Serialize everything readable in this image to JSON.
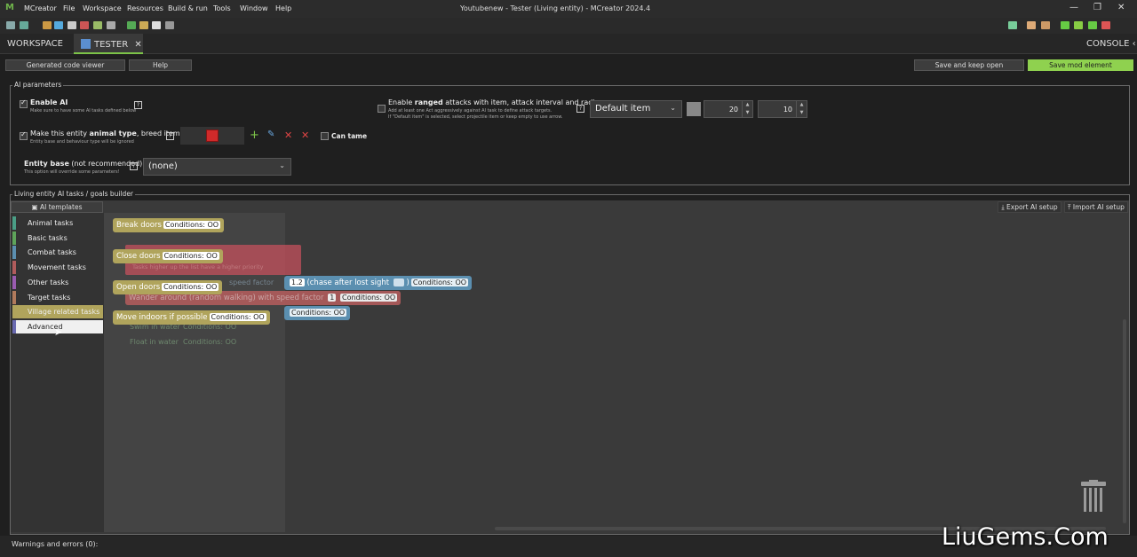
{
  "app": {
    "logo": "M",
    "menu": [
      "MCreator",
      "File",
      "Workspace",
      "Resources",
      "Build & run",
      "Tools",
      "Window",
      "Help"
    ],
    "title": "Youtubenew - Tester (Living entity) - MCreator 2024.4",
    "window_controls": [
      "—",
      "❐",
      "✕"
    ]
  },
  "tabs": {
    "workspace": "WORKSPACE",
    "tester": "TESTER",
    "close": "✕",
    "console": "CONSOLE",
    "console_arrow": "‹"
  },
  "buttons": {
    "generated_code": "Generated code viewer",
    "help": "Help",
    "save_keep": "Save and keep open",
    "save_mod": "Save mod element"
  },
  "ai_params": {
    "legend": "AI parameters",
    "enable_ai": "Enable AI",
    "enable_ai_sub": "Make sure to have some AI tasks defined below",
    "animal": "Make this entity ",
    "animal_bold": "animal type",
    "animal_rest": ", breed items:",
    "animal_sub": "Entity base and behaviour type will be ignored",
    "can_tame": "Can tame",
    "entity_base": "Entity base",
    "entity_base_rest": " (not recommended):",
    "entity_base_sub": "This option will override some parameters!",
    "entity_base_value": "(none)",
    "ranged_pre": "Enable ",
    "ranged_bold": "ranged",
    "ranged_post": " attacks with item, attack interval and radius:",
    "ranged_sub1": "Add at least one Act aggressively against AI task to define attack targets.",
    "ranged_sub2": "If \"Default item\" is selected, select projectile item or keep empty to use arrow.",
    "ranged_item": "Default item",
    "interval": "20",
    "radius": "10",
    "help": "?"
  },
  "builder": {
    "legend": "Living entity AI tasks / goals builder",
    "templates": "AI templates",
    "export": "Export AI setup",
    "import": "Import AI setup"
  },
  "categories": [
    {
      "label": "Animal tasks",
      "color": "#4a9e86"
    },
    {
      "label": "Basic tasks",
      "color": "#5ea35a"
    },
    {
      "label": "Combat tasks",
      "color": "#5b8fb0"
    },
    {
      "label": "Movement tasks",
      "color": "#b05c5c"
    },
    {
      "label": "Other tasks",
      "color": "#9a5cb0"
    },
    {
      "label": "Target tasks",
      "color": "#b07a5c"
    },
    {
      "label": "Village related tasks",
      "color": "#b0a45c"
    },
    {
      "label": "Advanced",
      "color": "#6a6ab0"
    }
  ],
  "blocks": [
    {
      "label": "Break doors",
      "cond": "Conditions: OO"
    },
    {
      "label": "Close doors",
      "cond": "Conditions: OO"
    },
    {
      "label": "Open doors",
      "cond": "Conditions: OO"
    },
    {
      "label": "Move indoors if possible",
      "cond": "Conditions: OO"
    }
  ],
  "bg_blocks": {
    "b1a": "1.2",
    "b1b": "(chase after lost sight",
    "b1c": ")",
    "b1d": "Conditions: OO",
    "b2a": "Wander around (random walking) with speed factor",
    "b2b": "1",
    "b2c": "Conditions: OO",
    "b3": "Conditions: OO",
    "g1": "Tasks higher up the list have a higher priority",
    "g2": "Swim in water",
    "g3": "Conditions: OO",
    "g4": "Float in water",
    "g5": "Conditions: OO",
    "g6": "speed factor"
  },
  "status": {
    "warnings": "Warnings and errors (0):"
  },
  "watermark": "LiuGems.Com"
}
